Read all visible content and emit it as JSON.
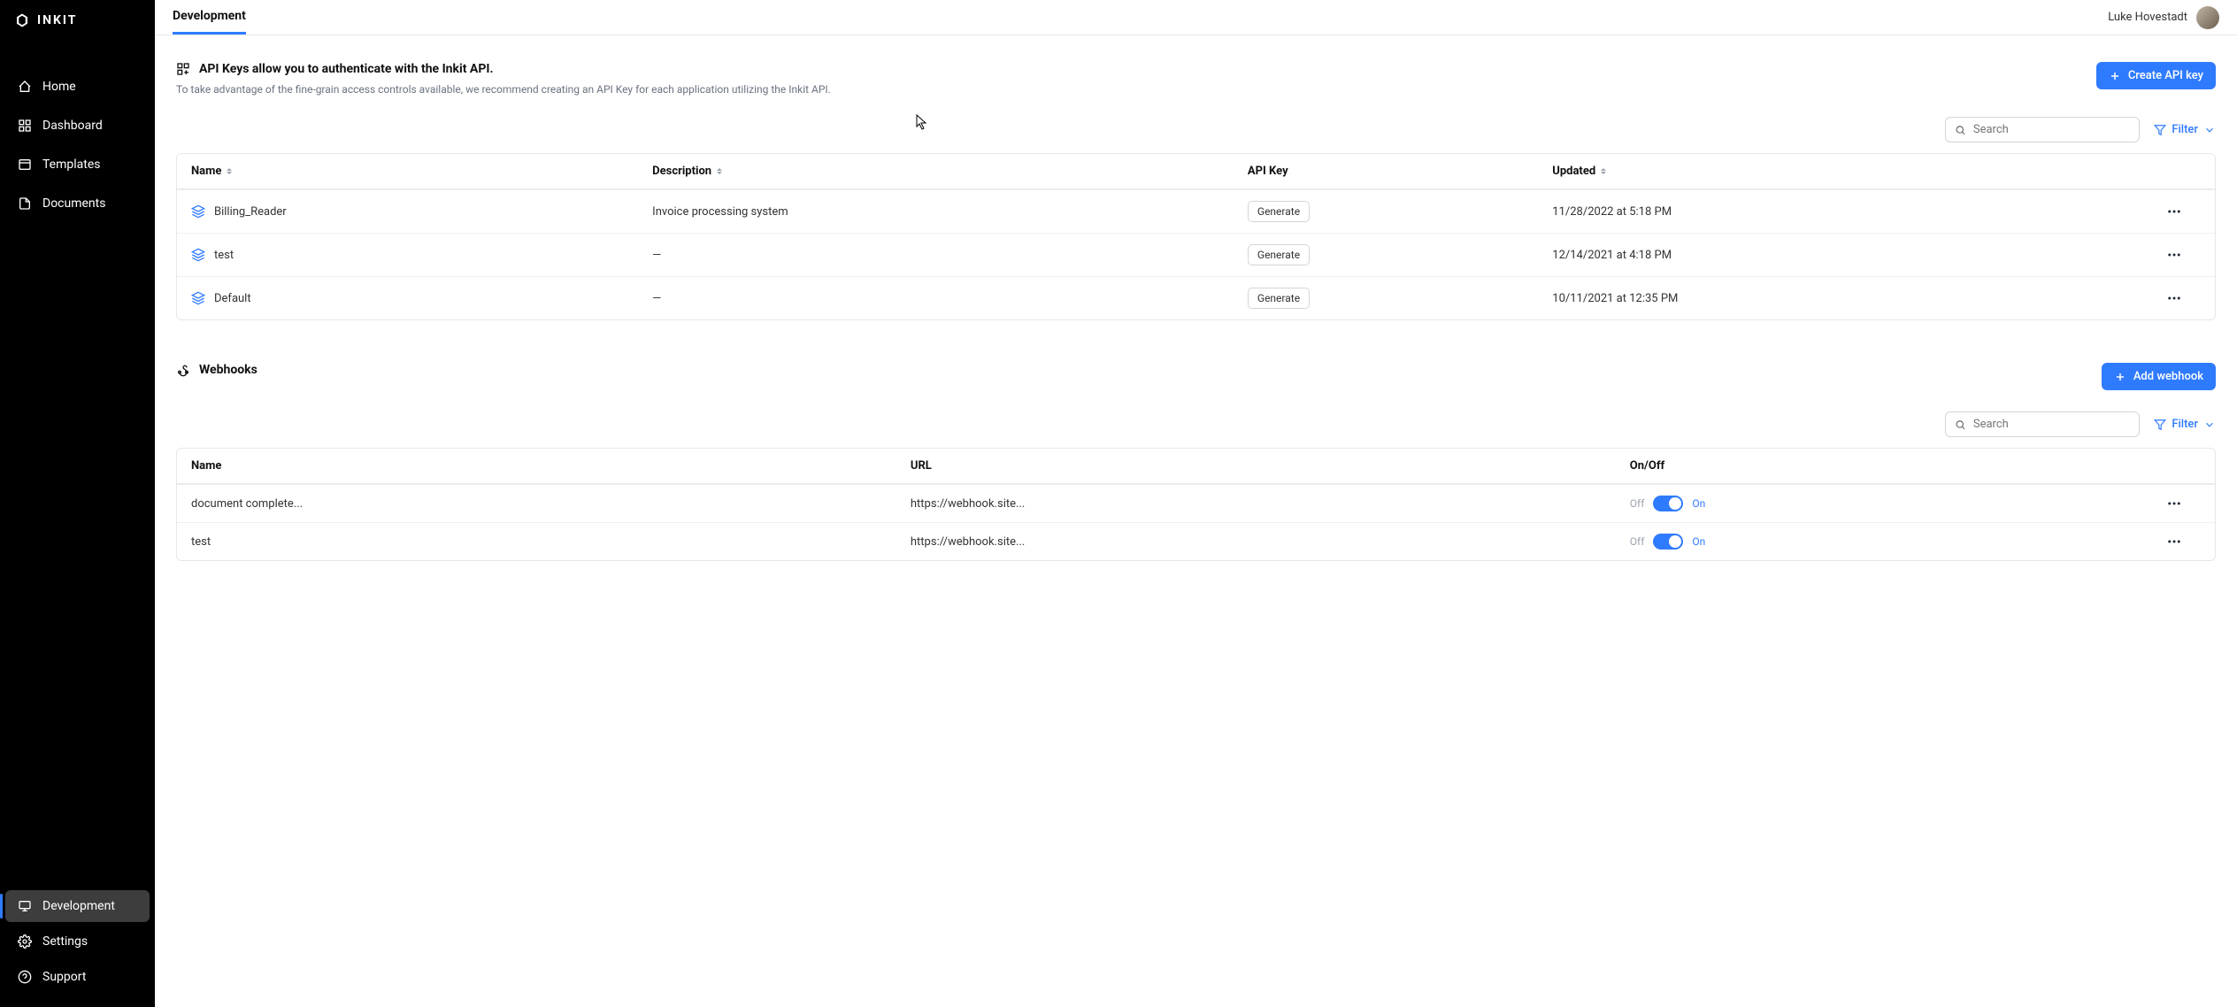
{
  "brand": "INKIT",
  "sidebar": {
    "items": [
      {
        "label": "Home"
      },
      {
        "label": "Dashboard"
      },
      {
        "label": "Templates"
      },
      {
        "label": "Documents"
      }
    ],
    "bottom": [
      {
        "label": "Development"
      },
      {
        "label": "Settings"
      },
      {
        "label": "Support"
      }
    ]
  },
  "header": {
    "tab": "Development",
    "user_name": "Luke Hovestadt"
  },
  "apikeys": {
    "title": "API Keys allow you to authenticate with the Inkit API.",
    "subtitle": "To take advantage of the fine-grain access controls available, we recommend creating an API Key for each application utilizing the Inkit API.",
    "create_btn": "Create API key",
    "search_placeholder": "Search",
    "filter_label": "Filter",
    "generate_label": "Generate",
    "columns": {
      "name": "Name",
      "description": "Description",
      "apikey": "API Key",
      "updated": "Updated"
    },
    "rows": [
      {
        "name": "Billing_Reader",
        "description": "Invoice processing system",
        "updated": "11/28/2022 at 5:18 PM"
      },
      {
        "name": "test",
        "description": "—",
        "updated": "12/14/2021 at 4:18 PM"
      },
      {
        "name": "Default",
        "description": "—",
        "updated": "10/11/2021 at 12:35 PM"
      }
    ]
  },
  "webhooks": {
    "title": "Webhooks",
    "add_btn": "Add webhook",
    "search_placeholder": "Search",
    "filter_label": "Filter",
    "toggle_off": "Off",
    "toggle_on": "On",
    "columns": {
      "name": "Name",
      "url": "URL",
      "onoff": "On/Off"
    },
    "rows": [
      {
        "name": "document complete...",
        "url": "https://webhook.site..."
      },
      {
        "name": "test",
        "url": "https://webhook.site..."
      }
    ]
  }
}
